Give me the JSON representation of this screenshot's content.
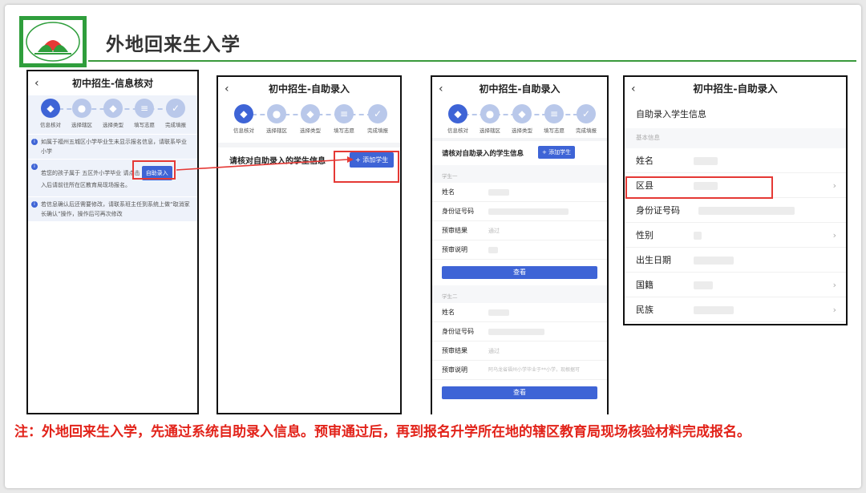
{
  "slide": {
    "title": "外地回来生入学",
    "note": "注：外地回来生入学，先通过系统自助录入信息。预审通过后，再到报名升学所在地的辖区教育局现场核验材料完成报名。"
  },
  "steps": [
    "信息核对",
    "选择辖区",
    "选择类型",
    "填写志愿",
    "完成填报"
  ],
  "phone1": {
    "title": "初中招生-信息核对",
    "notice1": "如属于福州五城区小学毕业生未显示报名信息，请联系毕业小学",
    "notice2a": "若您的孩子属于 五区外小学毕业 请点击",
    "notice2_btn": "自助录入",
    "notice2b": "入后请前往所在区教育局现场报名。",
    "notice3": "若信息确认后还需要修改，请联系班主任到系统上做“取消家长确认”操作，操作后可再次修改"
  },
  "phone2": {
    "title": "初中招生-自助录入",
    "heading": "请核对自助录入的学生信息",
    "add_btn": "+ 添加学生"
  },
  "phone3": {
    "title": "初中招生-自助录入",
    "heading": "请核对自助录入的学生信息",
    "add_btn": "+ 添加学生",
    "student1": "学生一",
    "student2": "学生二",
    "f_name": "姓名",
    "f_id": "身份证号码",
    "f_result": "预审结果",
    "f_desc": "预审说明",
    "s1_result": "通过",
    "s2_result": "通过",
    "s2_desc": "阿乌龙省福州小学毕业于**小学，现根据可",
    "view_btn": "查看"
  },
  "phone4": {
    "title": "初中招生-自助录入",
    "heading": "自助录入学生信息",
    "section": "基本信息",
    "fields": [
      "姓名",
      "区县",
      "身份证号码",
      "性别",
      "出生日期",
      "国籍",
      "民族"
    ]
  },
  "colors": {
    "accent": "#3e64d6",
    "red": "#e53935",
    "green": "#3a9a3c"
  }
}
